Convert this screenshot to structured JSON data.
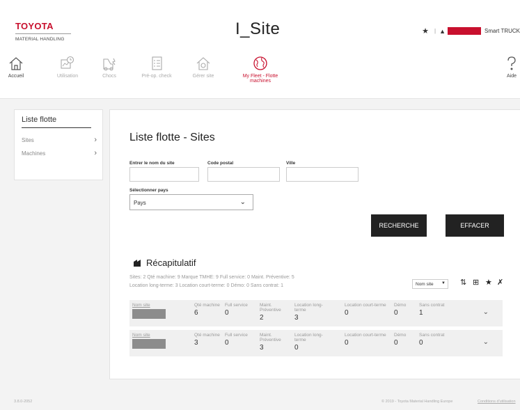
{
  "header": {
    "logo_main": "TOYOTA",
    "logo_sub": "MATERIAL HANDLING",
    "app_title": "I_Site",
    "company": "Smart TRUCK"
  },
  "nav": {
    "items": [
      {
        "label": "Accueil",
        "icon": "home-icon"
      },
      {
        "label": "Utilisation",
        "icon": "usage-icon"
      },
      {
        "label": "Chocs",
        "icon": "shock-icon"
      },
      {
        "label": "Pré-op. check",
        "icon": "checklist-icon"
      },
      {
        "label": "Gérer site",
        "icon": "manage-site-icon"
      },
      {
        "label": "My Fleet - Flotte machines",
        "icon": "globe-icon"
      },
      {
        "label": "Aide",
        "icon": "help-icon"
      }
    ]
  },
  "sidebar": {
    "title": "Liste flotte",
    "items": [
      {
        "label": "Sites"
      },
      {
        "label": "Machines"
      }
    ]
  },
  "main": {
    "title": "Liste flotte - Sites",
    "fields": {
      "site_name_label": "Entrer le nom du site",
      "site_name_value": "",
      "postal_label": "Code postal",
      "postal_value": "",
      "city_label": "Ville",
      "city_value": "",
      "country_label": "Sélectionner pays",
      "country_value": "Pays"
    },
    "buttons": {
      "search": "RECHERCHE",
      "clear": "EFFACER"
    },
    "recap": {
      "title": "Récapitulatif",
      "line1": "Sites: 2  Qté machine: 9  Marque TMHE: 9  Full service: 0  Maint. Préventive: 5",
      "line2": "Location long-terme: 3  Location court-terme: 0  Démo: 0  Sans contrat: 1",
      "sort_value": "Nom site"
    },
    "columns": {
      "name": "Nom site",
      "qty": "Qté machine",
      "full": "Full service",
      "maint": "Maint. Préventive",
      "long": "Location long-terme",
      "short": "Location court-terme",
      "demo": "Démo",
      "none": "Sans contrat"
    },
    "rows": [
      {
        "qty": "6",
        "full": "0",
        "maint": "2",
        "long": "3",
        "short": "0",
        "demo": "0",
        "none": "1"
      },
      {
        "qty": "3",
        "full": "0",
        "maint": "3",
        "long": "0",
        "short": "0",
        "demo": "0",
        "none": "0"
      }
    ]
  },
  "footer": {
    "version": "3.8.0-2052",
    "copyright": "© 2019 - Toyota Material Handling Europe",
    "link": "Conditions d'utilisation"
  },
  "colors": {
    "brand": "#c8102e",
    "button": "#222222",
    "background": "#f3f3f3"
  }
}
